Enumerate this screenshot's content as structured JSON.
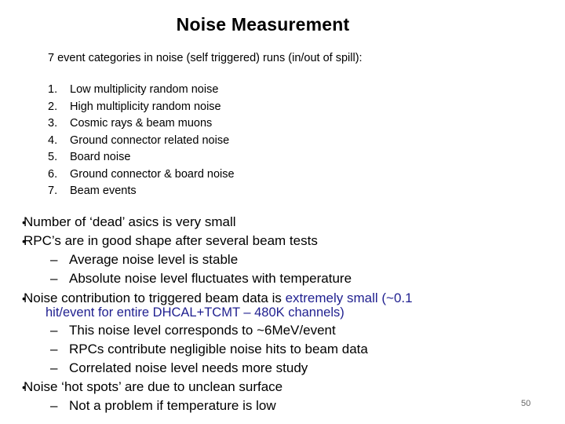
{
  "slide": {
    "title": "Noise Measurement",
    "intro": "7 event categories in noise (self triggered) runs (in/out of spill):",
    "categories": [
      {
        "num": "1.",
        "label": "Low multiplicity random noise"
      },
      {
        "num": "2.",
        "label": "High multiplicity random noise"
      },
      {
        "num": "3.",
        "label": "Cosmic rays & beam muons"
      },
      {
        "num": "4.",
        "label": "Ground connector related noise"
      },
      {
        "num": "5.",
        "label": "Board noise"
      },
      {
        "num": "6.",
        "label": "Ground connector & board noise"
      },
      {
        "num": "7.",
        "label": "Beam events"
      }
    ],
    "bullet_marker": "•",
    "dash_marker": "–",
    "bullets": [
      {
        "text": "Number of ‘dead’ asics is very small"
      },
      {
        "text": "RPC’s are in good shape after several beam tests",
        "sub": [
          "Average noise level is stable",
          "Absolute noise level fluctuates with temperature"
        ]
      },
      {
        "text_plain": "Noise contribution to triggered beam data is ",
        "text_highlight_line1": "extremely small (~0.1",
        "text_highlight_line2": "hit/event for entire DHCAL+TCMT – 480K channels)",
        "highlight_color": "#1f1f8f",
        "sub": [
          "This noise level corresponds to ~6MeV/event",
          "RPCs contribute negligible noise hits to beam data",
          "Correlated noise level needs more study"
        ]
      },
      {
        "text": "Noise ‘hot spots’ are due to unclean surface",
        "sub": [
          "Not a problem if temperature is low"
        ]
      }
    ],
    "page_number": "50"
  }
}
